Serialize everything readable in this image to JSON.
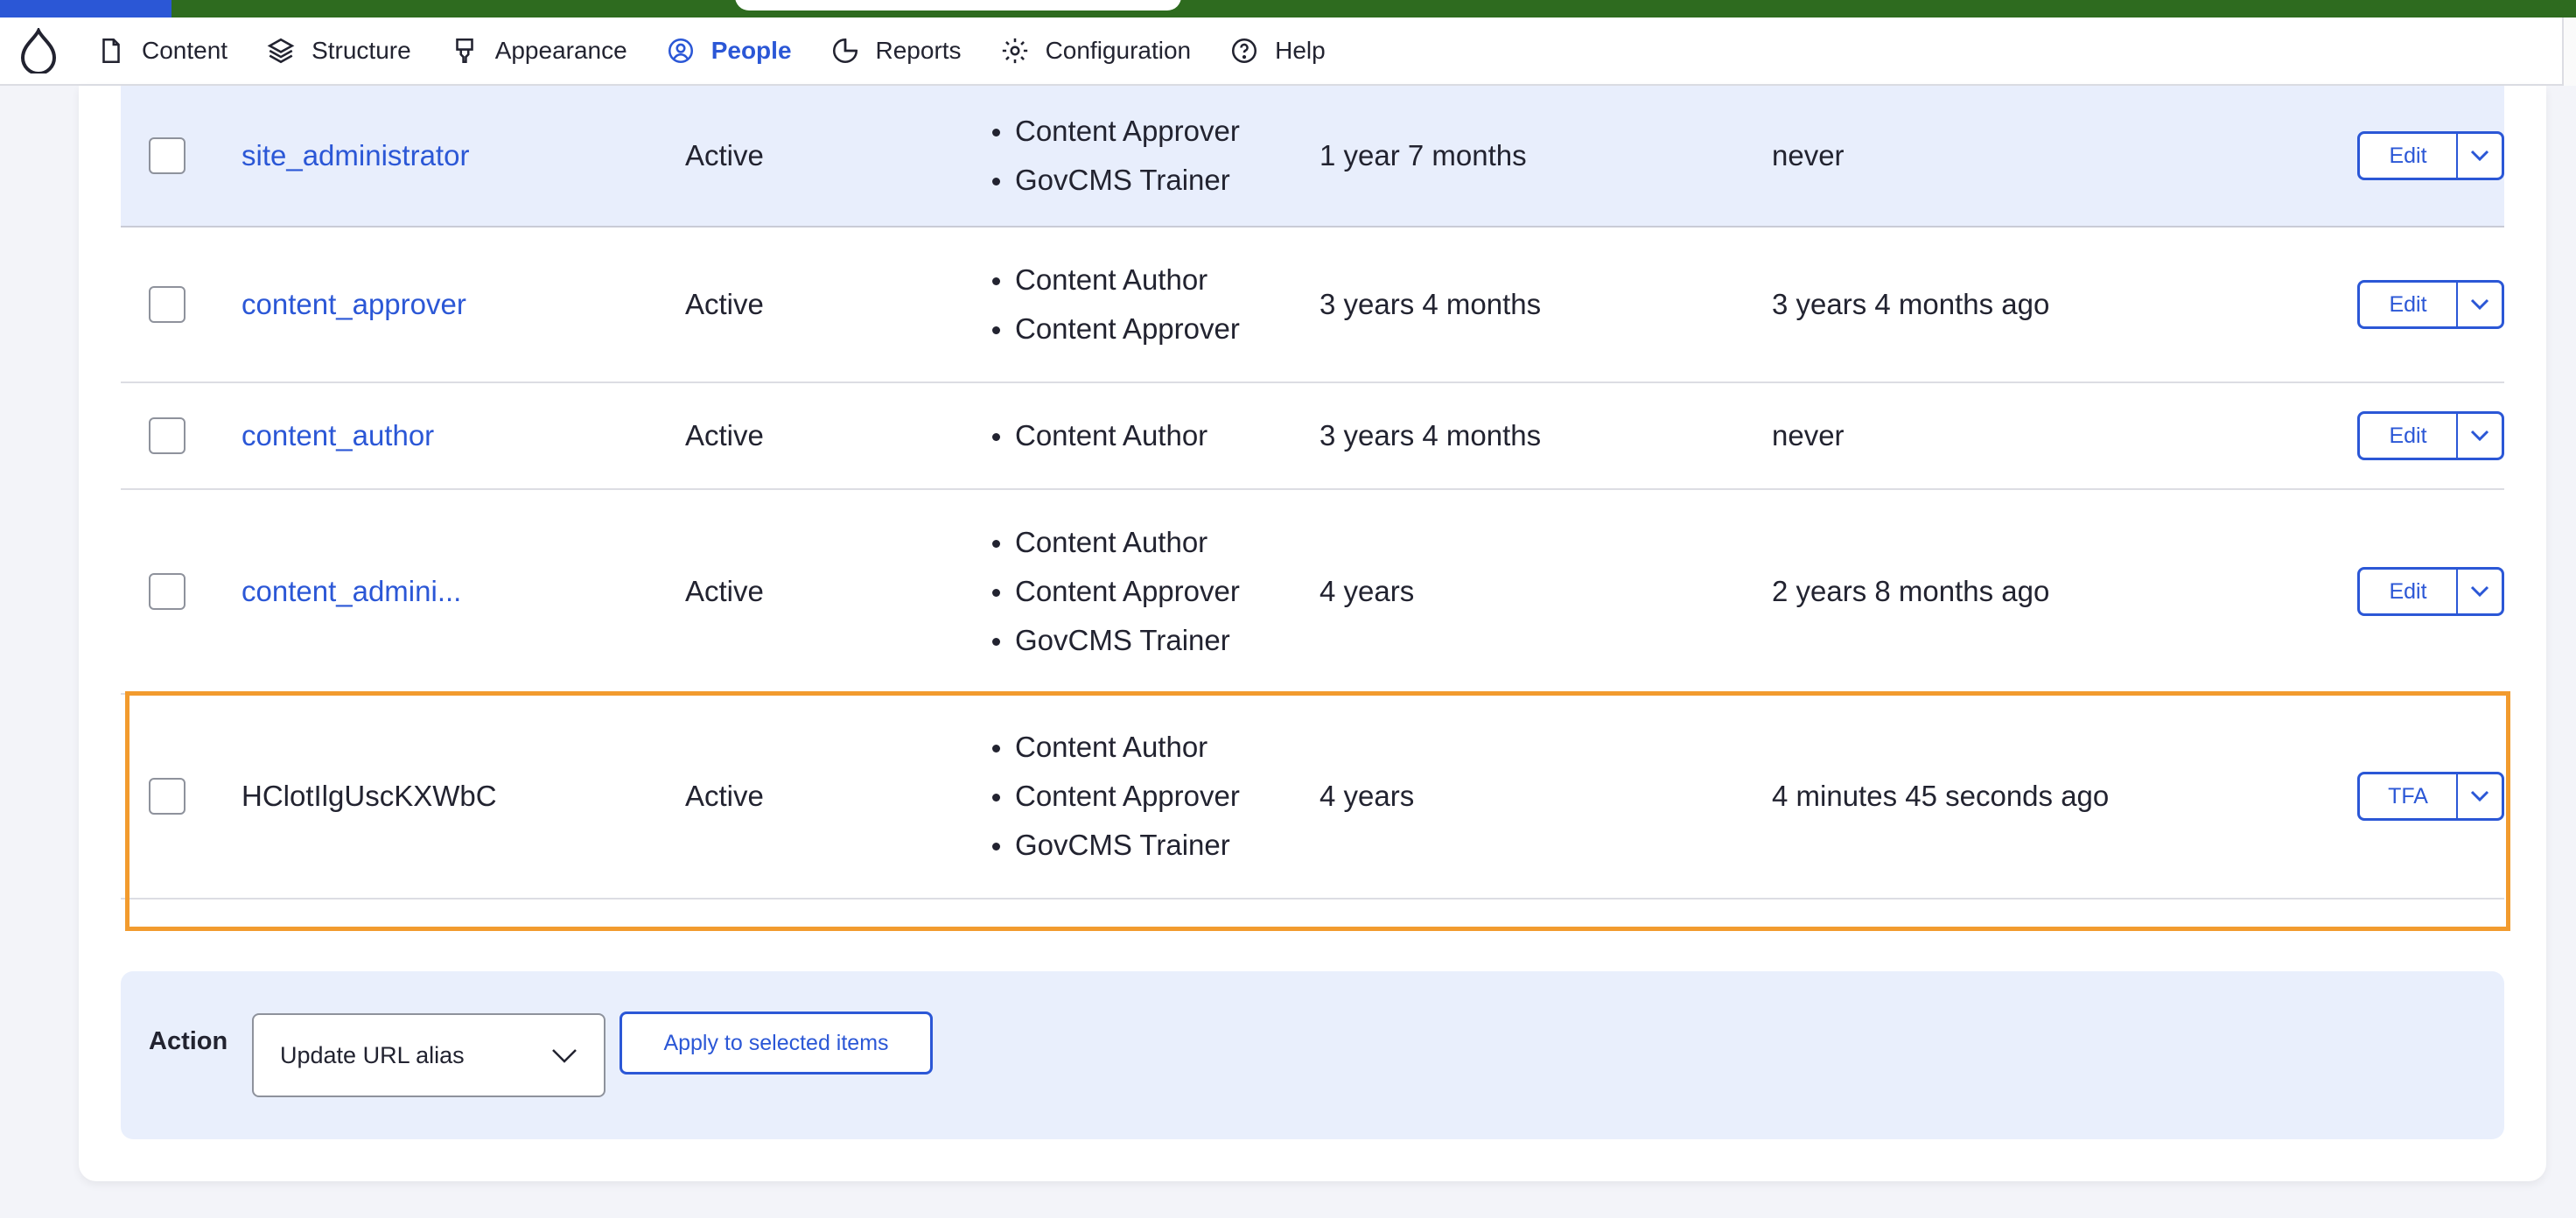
{
  "toolbar": {
    "items": [
      {
        "label": "Content",
        "icon": "file-icon"
      },
      {
        "label": "Structure",
        "icon": "layers-icon"
      },
      {
        "label": "Appearance",
        "icon": "brush-icon"
      },
      {
        "label": "People",
        "icon": "user-circle-icon",
        "active": true
      },
      {
        "label": "Reports",
        "icon": "pie-chart-icon"
      },
      {
        "label": "Configuration",
        "icon": "gear-icon"
      },
      {
        "label": "Help",
        "icon": "help-icon"
      }
    ]
  },
  "rows": [
    {
      "username": "site_administrator",
      "status": "Active",
      "roles": [
        "Content Approver",
        "GovCMS Trainer"
      ],
      "member_for": "1 year 7 months",
      "last_access": "never",
      "op": "Edit"
    },
    {
      "username": "content_approver",
      "status": "Active",
      "roles": [
        "Content Author",
        "Content Approver"
      ],
      "member_for": "3 years 4 months",
      "last_access": "3 years 4 months ago",
      "op": "Edit"
    },
    {
      "username": "content_author",
      "status": "Active",
      "roles": [
        "Content Author"
      ],
      "member_for": "3 years 4 months",
      "last_access": "never",
      "op": "Edit"
    },
    {
      "username": "content_admini...",
      "status": "Active",
      "roles": [
        "Content Author",
        "Content Approver",
        "GovCMS Trainer"
      ],
      "member_for": "4 years",
      "last_access": "2 years 8 months ago",
      "op": "Edit"
    },
    {
      "username": "HClotIlgUscKXWbC",
      "status": "Active",
      "roles": [
        "Content Author",
        "Content Approver",
        "GovCMS Trainer"
      ],
      "member_for": "4 years",
      "last_access": "4 minutes 45 seconds ago",
      "op": "TFA"
    }
  ],
  "bulk": {
    "label": "Action",
    "selected_action": "Update URL alias",
    "apply_label": "Apply to selected items"
  },
  "colors": {
    "accent": "#2b57d6",
    "highlight": "#f29b2e",
    "selected_row": "#e8eefc",
    "top_strip": "#2e6b1f"
  }
}
